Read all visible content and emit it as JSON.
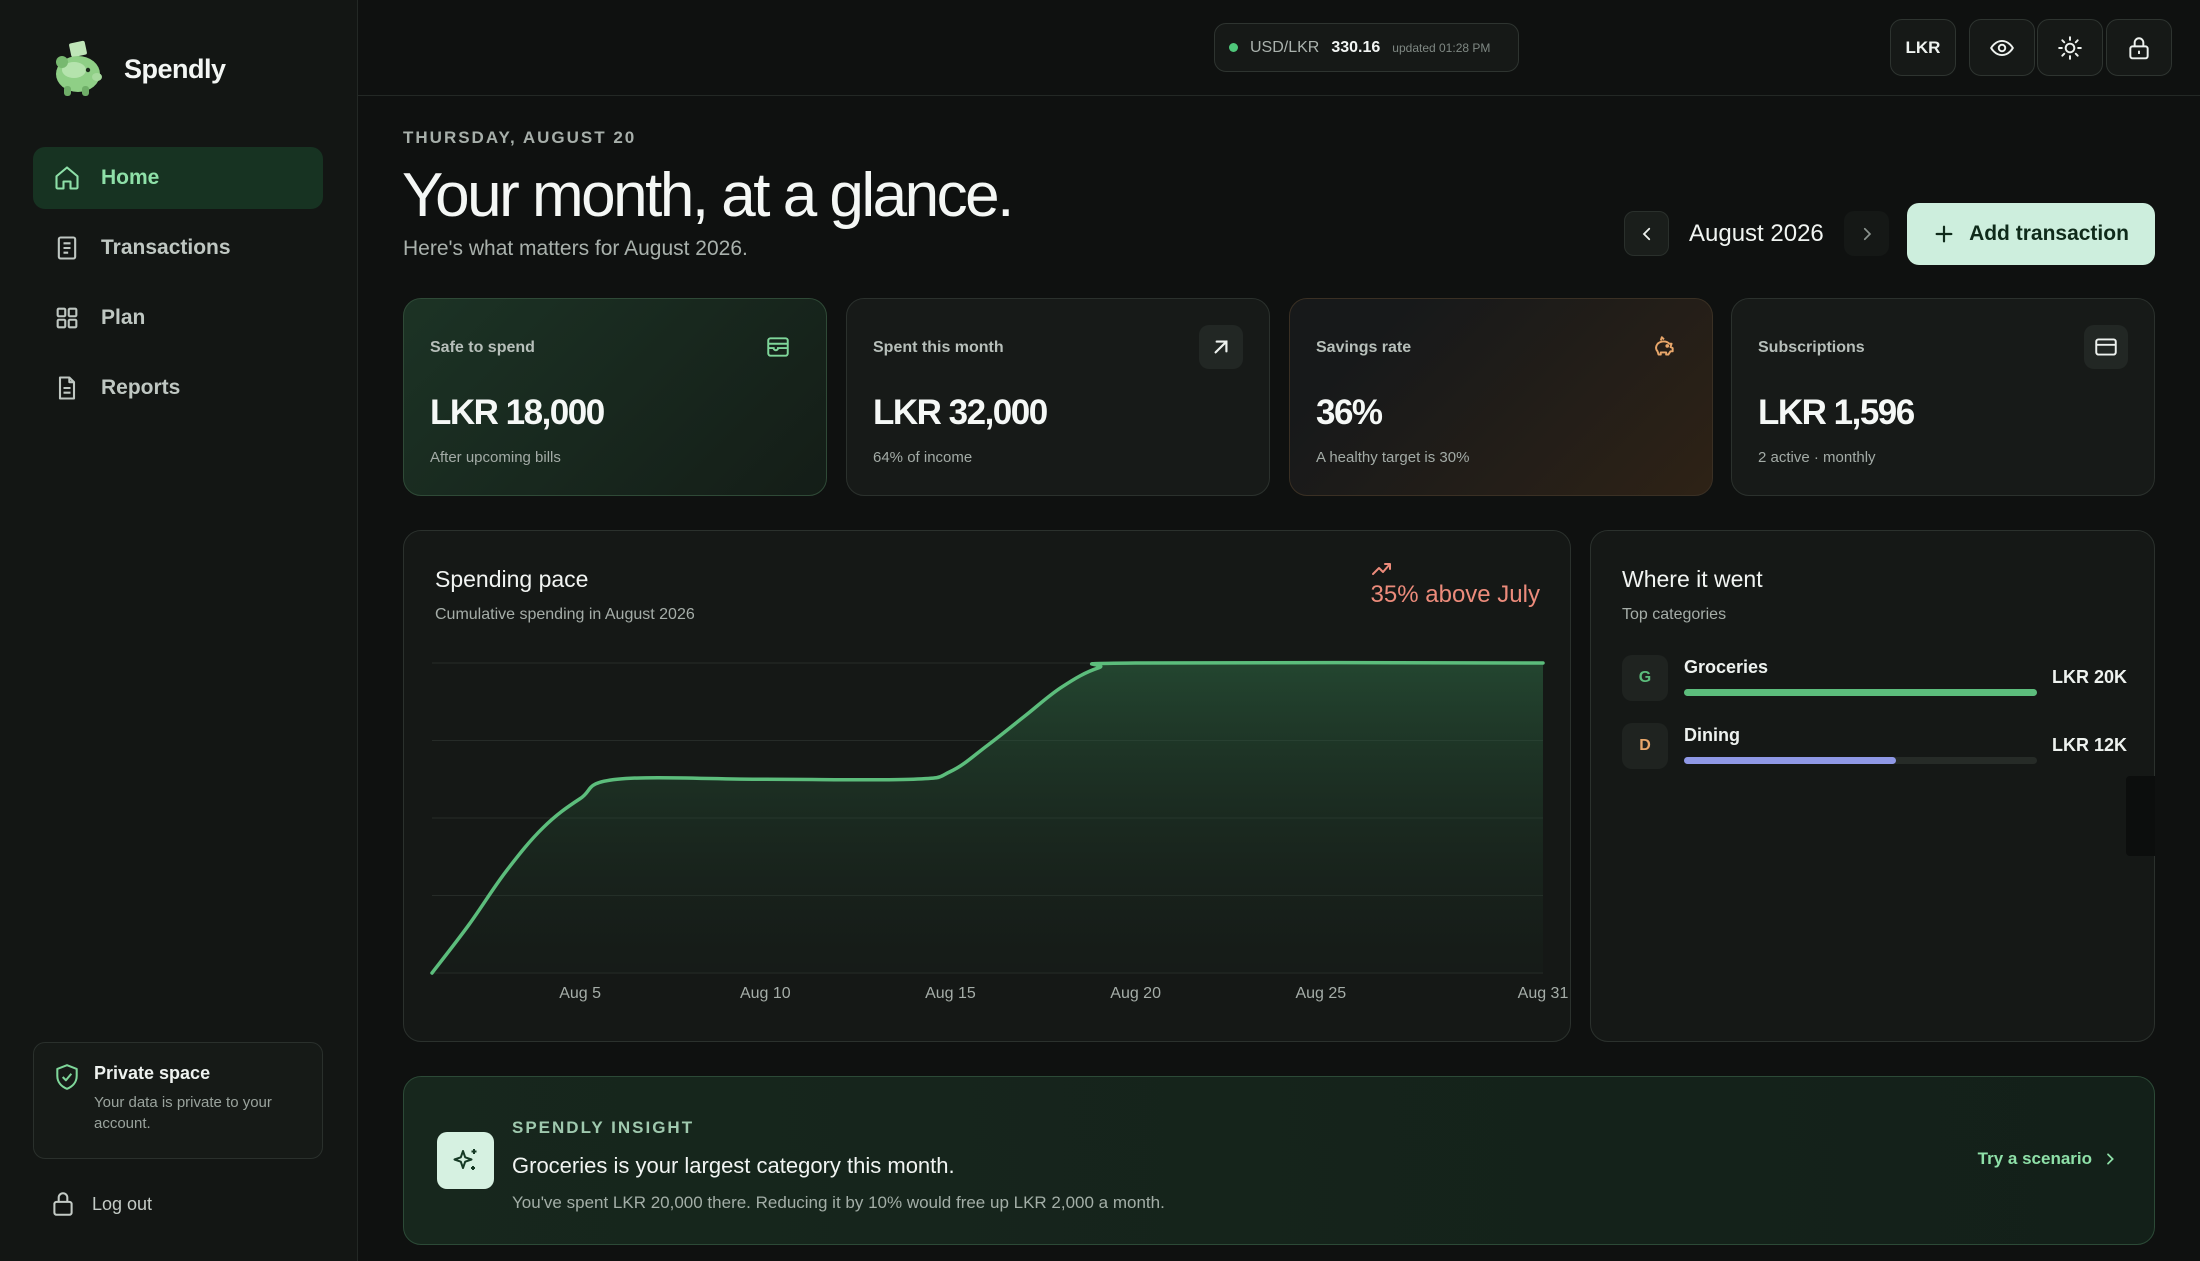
{
  "brand": {
    "name": "Spendly",
    "logo_icon": "piggy-bank-logo-icon"
  },
  "sidebar": {
    "items": [
      {
        "label": "Home",
        "icon": "home-icon",
        "active": true
      },
      {
        "label": "Transactions",
        "icon": "receipt-icon",
        "active": false
      },
      {
        "label": "Plan",
        "icon": "grid-icon",
        "active": false
      },
      {
        "label": "Reports",
        "icon": "document-icon",
        "active": false
      }
    ],
    "private_title": "Private space",
    "private_text": "Your data is private to your account.",
    "logout_label": "Log out"
  },
  "topbar": {
    "rate_pair": "USD/LKR",
    "rate_value": "330.16",
    "rate_updated": "updated 01:28 PM",
    "currency_label": "LKR"
  },
  "header": {
    "date": "THURSDAY, AUGUST 20",
    "headline": "Your month, at a glance.",
    "subline": "Here's what matters for August 2026.",
    "month_label": "August 2026",
    "add_label": "Add transaction"
  },
  "kpis": [
    {
      "label": "Safe to spend",
      "value": "LKR 18,000",
      "sub": "After upcoming bills",
      "icon": "wallet-icon"
    },
    {
      "label": "Spent this month",
      "value": "LKR 32,000",
      "sub": "64% of income",
      "icon": "arrow-up-right-icon"
    },
    {
      "label": "Savings rate",
      "value": "36%",
      "sub": "A healthy target is 30%",
      "icon": "piggy-bank-icon"
    },
    {
      "label": "Subscriptions",
      "value": "LKR 1,596",
      "sub": "2 active · monthly",
      "icon": "credit-card-icon"
    }
  ],
  "chart": {
    "title": "Spending pace",
    "subtitle": "Cumulative spending in August 2026",
    "trend_text": "35% above July",
    "trend_color": "#ec8b7b",
    "line_color": "#5cbd7c"
  },
  "chart_data": {
    "type": "area",
    "title": "Spending pace",
    "subtitle": "Cumulative spending in August 2026",
    "x_tick_labels": [
      "Aug 5",
      "Aug 10",
      "Aug 15",
      "Aug 20",
      "Aug 25",
      "Aug 31"
    ],
    "x_tick_days": [
      5,
      10,
      15,
      20,
      25,
      31
    ],
    "xlim": [
      1,
      31
    ],
    "ylim": [
      0,
      32000
    ],
    "grid": true,
    "legend": "none",
    "x": [
      1,
      2,
      3,
      4,
      5,
      6,
      10,
      14,
      15,
      16,
      17,
      18,
      19,
      20,
      31
    ],
    "values": [
      0,
      5000,
      10500,
      15000,
      18000,
      20000,
      20000,
      20000,
      20800,
      23500,
      26500,
      29500,
      31500,
      32000,
      32000
    ]
  },
  "categories": {
    "title": "Where it went",
    "subtitle": "Top categories",
    "items": [
      {
        "initial": "G",
        "name": "Groceries",
        "amount": "LKR 20K",
        "share": 1.0,
        "color": "#5cbd7c",
        "badge_color": "#5cbd7c"
      },
      {
        "initial": "D",
        "name": "Dining",
        "amount": "LKR 12K",
        "share": 0.6,
        "color": "#8f98e6",
        "badge_color": "#e8a66a"
      }
    ]
  },
  "insight": {
    "eyebrow": "SPENDLY INSIGHT",
    "title": "Groceries is your largest category this month.",
    "text": "You've spent LKR 20,000 there. Reducing it by 10% would free up LKR 2,000 a month.",
    "link_label": "Try a scenario",
    "icon": "sparkles-icon"
  }
}
